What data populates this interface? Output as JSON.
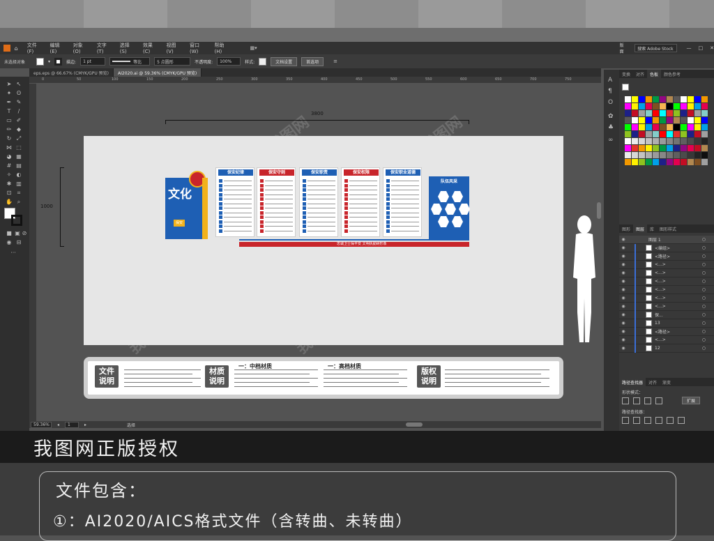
{
  "menubar": {
    "items": [
      "文件(F)",
      "编辑(E)",
      "对象(O)",
      "文字(T)",
      "选择(S)",
      "效果(C)",
      "视图(V)",
      "窗口(W)",
      "帮助(H)"
    ],
    "workspace": "版面",
    "search_placeholder": "搜索 Adobe Stock"
  },
  "control": {
    "selection_label": "未选择对象",
    "stroke_label": "描边:",
    "stroke_value": "1 pt",
    "line_style": "等比",
    "brush_value": "5 点圆形",
    "opacity_label": "不透明度:",
    "opacity_value": "100%",
    "style_label": "样式:",
    "doc_setup": "文档设置",
    "prefs": "首选项"
  },
  "tabs": [
    {
      "label": "eps.eps @ 66.67% (CMYK/GPU 预览)",
      "active": false
    },
    {
      "label": "AI2020.ai @ 59.36% (CMYK/GPU 预览)",
      "active": true
    }
  ],
  "rulers": {
    "h": [
      "0",
      "50",
      "100",
      "150",
      "200",
      "250",
      "300",
      "350",
      "400",
      "450",
      "500",
      "550",
      "600",
      "650",
      "700",
      "750"
    ]
  },
  "artboard": {
    "width_dim": "3800",
    "height_dim": "1000",
    "culture_title": "文化",
    "culture_sub": "保安",
    "panels": [
      "保安纪律",
      "保安守则",
      "保安职责",
      "保安权限",
      "保安职业道德",
      "队伍风采"
    ],
    "slogan": "忠诚卫士保平安 文明执勤树形象"
  },
  "infobox": {
    "file_desc": "文件说明",
    "material_desc": "材质说明",
    "copyright_desc": "版权说明",
    "mid_material": "一：中档材质",
    "high_material": "一：高档材质"
  },
  "statusbar": {
    "zoom": "59.36%",
    "page": "1",
    "tool": "选择"
  },
  "rightpanel": {
    "top_tabs": [
      "变换",
      "对齐",
      "色板",
      "颜色参考"
    ],
    "layer_tabs": [
      "图形",
      "图层",
      "库",
      "图形样式"
    ],
    "layer_name": "图层 1",
    "layers": [
      "<编组>",
      "<路径>",
      "<...>",
      "<...>",
      "<...>",
      "<...>",
      "<...>",
      "<...>",
      "保...",
      "13",
      "<路径>",
      "<...>",
      "12"
    ],
    "pathfinder_tabs": [
      "路径查找器",
      "对齐",
      "渐变"
    ],
    "shape_modes": "形状模式：",
    "expand": "扩展",
    "pathfinder": "路径查找器："
  },
  "banner": "我图网正版授权",
  "bottom": {
    "line1": "文件包含：",
    "line2": "①：AI2020/AICS格式文件（含转曲、未转曲）"
  },
  "watermark": "我图网",
  "colors": {
    "blue": "#1e5fb4",
    "red": "#c8252b",
    "yellow": "#f2b21b"
  }
}
